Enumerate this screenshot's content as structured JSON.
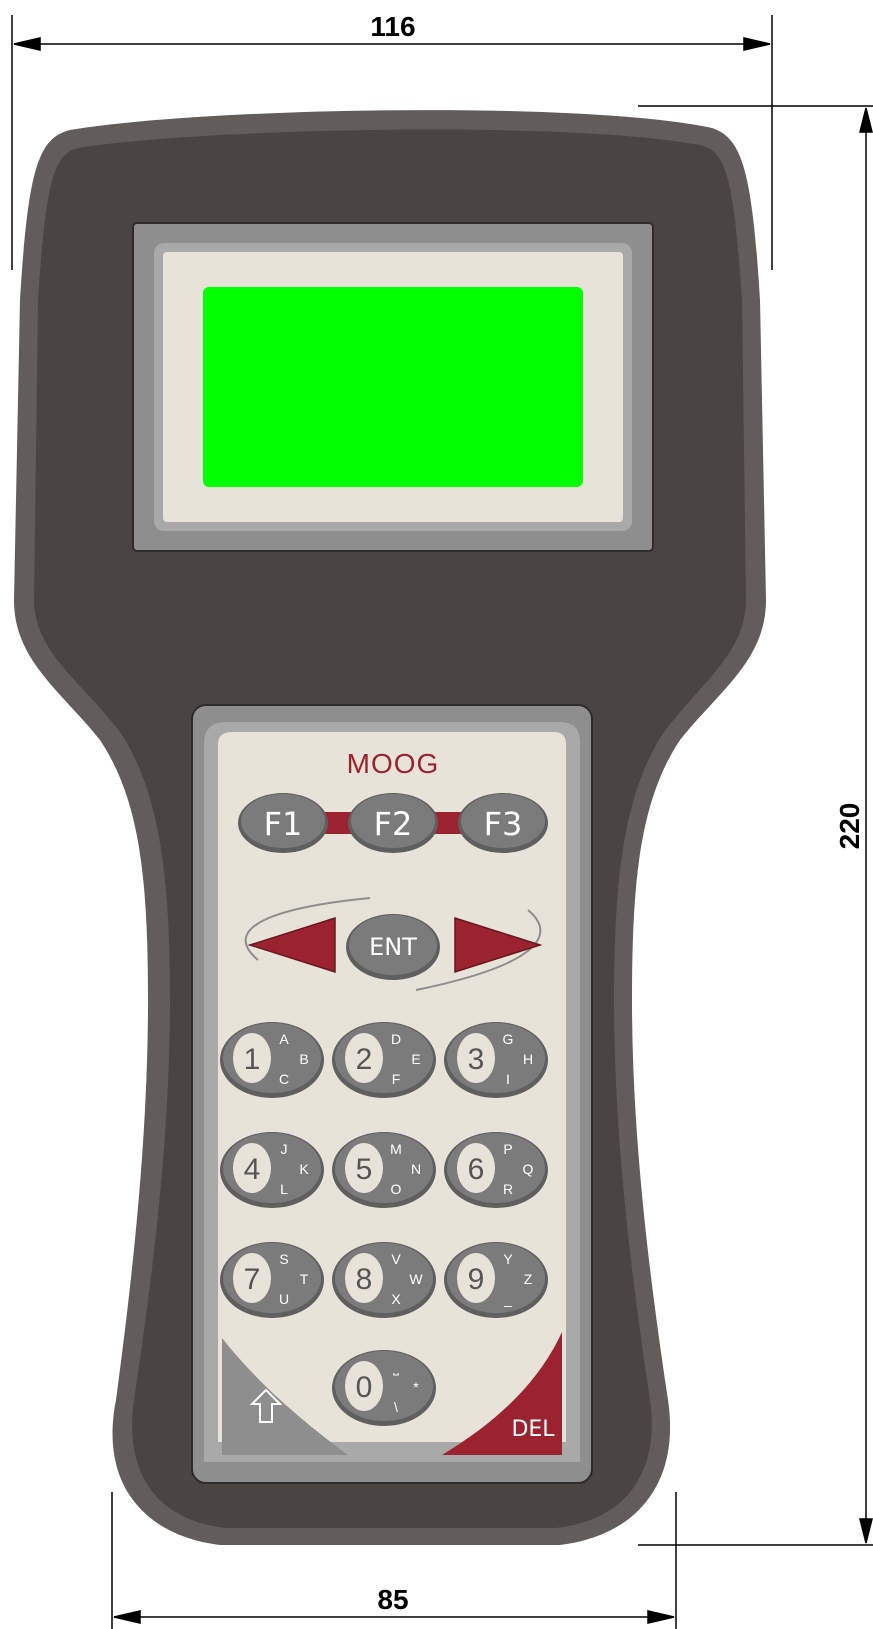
{
  "dimensions": {
    "top_width": "116",
    "bottom_width": "85",
    "height": "220"
  },
  "display": {
    "screen_color": "#00ff00"
  },
  "brand": {
    "name": "MOOG",
    "color": "#9b2330"
  },
  "function_keys": [
    "F1",
    "F2",
    "F3"
  ],
  "nav": {
    "left": "left-arrow",
    "enter": "ENT",
    "right": "right-arrow"
  },
  "keypad": [
    {
      "num": "1",
      "l1": "A",
      "l2": "B",
      "l3": "C"
    },
    {
      "num": "2",
      "l1": "D",
      "l2": "E",
      "l3": "F"
    },
    {
      "num": "3",
      "l1": "G",
      "l2": "H",
      "l3": "I"
    },
    {
      "num": "4",
      "l1": "J",
      "l2": "K",
      "l3": "L"
    },
    {
      "num": "5",
      "l1": "M",
      "l2": "N",
      "l3": "O"
    },
    {
      "num": "6",
      "l1": "P",
      "l2": "Q",
      "l3": "R"
    },
    {
      "num": "7",
      "l1": "S",
      "l2": "T",
      "l3": "U"
    },
    {
      "num": "8",
      "l1": "V",
      "l2": "W",
      "l3": "X"
    },
    {
      "num": "9",
      "l1": "Y",
      "l2": "Z",
      "l3": "_"
    },
    {
      "num": "0",
      "l1": "⎵",
      "l2": "*",
      "l3": "\\"
    }
  ],
  "shift_key": {
    "icon": "up-arrow-icon"
  },
  "delete_key": {
    "label": "DEL"
  },
  "colors": {
    "body": "#4a4443",
    "body_edge": "#625c5a",
    "panel": "#e7e3d9",
    "key": "#7b7b7b",
    "accent": "#9b2330"
  }
}
